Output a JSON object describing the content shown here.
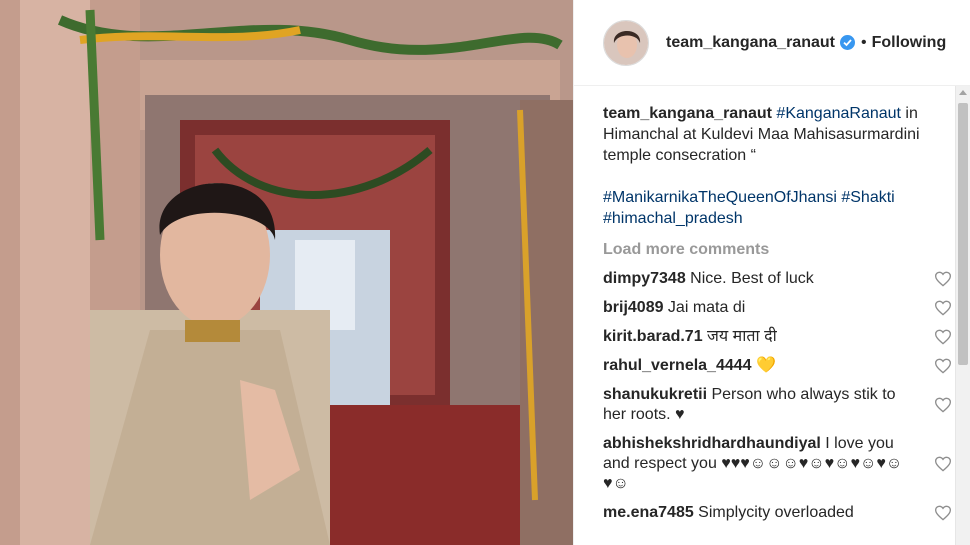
{
  "post": {
    "username": "team_kangana_ranaut",
    "follow_status": "Following",
    "dot": "•"
  },
  "caption": {
    "username": "team_kangana_ranaut",
    "tag1": "#KanganaRanaut",
    "text": " in Himanchal at Kuldevi Maa Mahisasurmardini temple consecration “",
    "tag2": "#ManikarnikaTheQueenOfJhansi",
    "tag3": "#Shakti",
    "tag4": "#himachal_pradesh"
  },
  "load_more": "Load more comments",
  "comments": [
    {
      "user": "dimpy7348",
      "text": " Nice. Best of luck"
    },
    {
      "user": "brij4089",
      "text": " Jai mata di"
    },
    {
      "user": "kirit.barad.71",
      "text": " जय माता दी"
    },
    {
      "user": "rahul_vernela_4444",
      "text": " 💛"
    },
    {
      "user": "shanukukretii",
      "text": " Person who always stik to her roots. ♥"
    },
    {
      "user": "abhishekshridhardhaundiyal",
      "text": " I love you and respect you ♥♥♥☺☺☺♥☺♥☺♥☺♥☺♥☺"
    },
    {
      "user": "me.ena7485",
      "text": " Simplycity overloaded"
    }
  ],
  "colors": {
    "link": "#003569",
    "muted": "#999999",
    "verified": "#3897f0"
  }
}
